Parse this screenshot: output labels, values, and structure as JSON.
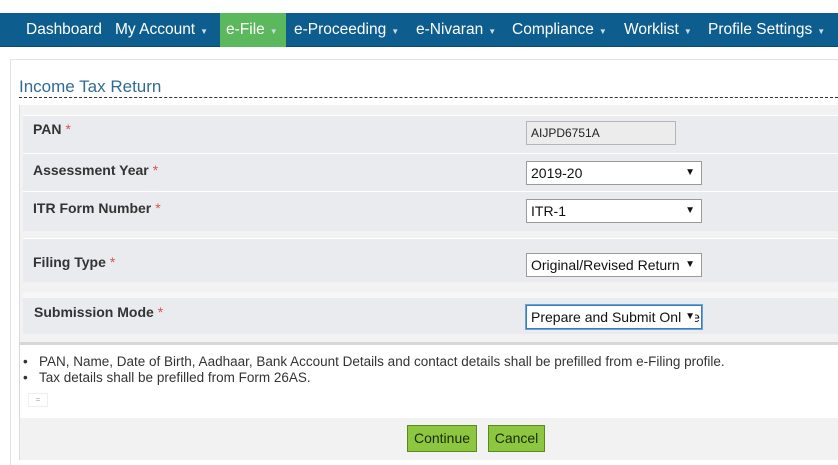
{
  "nav": {
    "items": [
      {
        "label": "Dashboard",
        "dropdown": false
      },
      {
        "label": "My Account",
        "dropdown": true
      },
      {
        "label": "e-File",
        "dropdown": true,
        "active": true
      },
      {
        "label": "e-Proceeding",
        "dropdown": true
      },
      {
        "label": "e-Nivaran",
        "dropdown": true
      },
      {
        "label": "Compliance",
        "dropdown": true
      },
      {
        "label": "Worklist",
        "dropdown": true
      },
      {
        "label": "Profile Settings",
        "dropdown": true
      }
    ],
    "active_color": "#5cb85c",
    "bar_color": "#0d5e8e"
  },
  "page": {
    "title": "Income Tax Return"
  },
  "form": {
    "required_mark": "*",
    "pan": {
      "label": "PAN",
      "value": "AIJPD6751A"
    },
    "assessment_year": {
      "label": "Assessment Year",
      "value": "2019-20"
    },
    "itr_form": {
      "label": "ITR Form Number",
      "value": "ITR-1"
    },
    "filing_type": {
      "label": "Filing Type",
      "value": "Original/Revised Return"
    },
    "submission_mode": {
      "label": "Submission Mode",
      "value": "Prepare and Submit Online"
    }
  },
  "info": {
    "lines": [
      "PAN, Name, Date of Birth, Aadhaar, Bank Account Details and contact details shall be prefilled from e-Filing profile.",
      "Tax details shall be prefilled from Form 26AS."
    ],
    "bullet": "•"
  },
  "buttons": {
    "continue": "Continue",
    "cancel": "Cancel"
  }
}
